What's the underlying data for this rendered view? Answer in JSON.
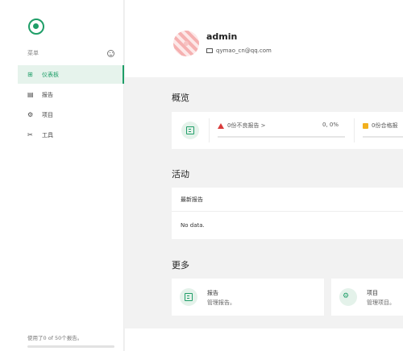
{
  "sidebar": {
    "menu_label": "菜单",
    "items": [
      {
        "label": "仪表板",
        "icon": "dashboard-icon",
        "glyph": "⊞",
        "active": true
      },
      {
        "label": "报告",
        "icon": "report-icon",
        "glyph": "▤",
        "active": false
      },
      {
        "label": "项目",
        "icon": "project-icon",
        "glyph": "⚙",
        "active": false
      },
      {
        "label": "工具",
        "icon": "tools-icon",
        "glyph": "✂",
        "active": false
      }
    ],
    "usage_text": "使用了0 of 50个报告。",
    "usage_fraction": 0
  },
  "user": {
    "name": "admin",
    "email": "qymao_cn@qq.com"
  },
  "overview": {
    "title": "概览",
    "bad_reports": "0份不良报告 >",
    "bad_stats": "0, 0%",
    "good_reports": "0份合格报"
  },
  "activity": {
    "title": "活动",
    "header": "最新报告",
    "empty": "No data."
  },
  "more": {
    "title": "更多",
    "cards": [
      {
        "title": "报告",
        "desc": "管理报告。",
        "icon": "report-icon"
      },
      {
        "title": "项目",
        "desc": "管理项目。",
        "icon": "project-icon"
      }
    ]
  },
  "colors": {
    "accent": "#1f9e68",
    "danger": "#d93b3b",
    "warning": "#f2b01e"
  }
}
